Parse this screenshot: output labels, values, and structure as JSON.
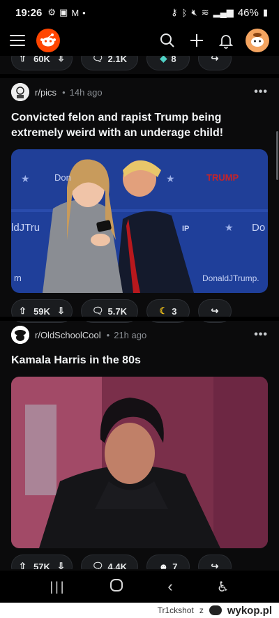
{
  "status": {
    "time": "19:26",
    "battery": "46%"
  },
  "header": {
    "title": ""
  },
  "previous_post": {
    "votes": "60K",
    "comments": "2.1K",
    "awards": "8"
  },
  "posts": [
    {
      "subreddit": "r/pics",
      "age": "14h ago",
      "title": "Convicted felon and rapist Trump being extremely weird with an underage child!",
      "image_text": {
        "banner_left": "Don",
        "banner_right": "TRUMP",
        "side_left": "ldJTru",
        "side_mid": "IP",
        "side_right": "Do",
        "bottom_left": "m",
        "bottom_right": "DonaldJTrump."
      },
      "votes": "59K",
      "comments": "5.7K",
      "awards": "3"
    },
    {
      "subreddit": "r/OldSchoolCool",
      "age": "21h ago",
      "title": "Kamala Harris in the 80s",
      "votes": "57K",
      "comments": "4.4K",
      "awards": "7"
    }
  ],
  "watermark": {
    "user": "Tr1ckshot",
    "suffix": "z",
    "brand": "wykop.pl"
  },
  "colors": {
    "background": "#0b0b0c",
    "reddit_orange": "#ff4500",
    "pill": "#1a1c1f"
  }
}
